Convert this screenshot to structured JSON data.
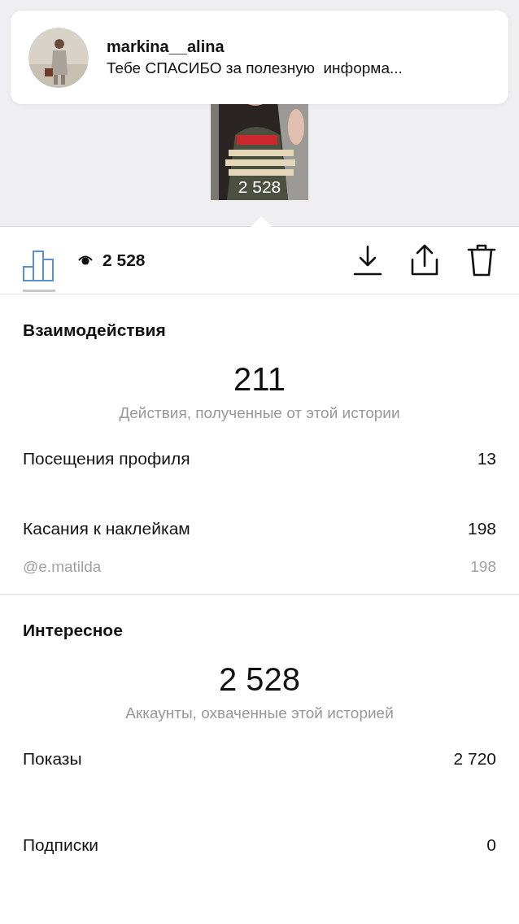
{
  "notification": {
    "username": "markina__alina",
    "message": "Тебе СПАСИБО за полезную  информа..."
  },
  "story": {
    "views": "2 528"
  },
  "toolbar": {
    "views": "2 528",
    "insights_selected": true
  },
  "sections": [
    {
      "title": "Взаимодействия",
      "total": "211",
      "caption": "Действия, полученные от этой истории",
      "rows": [
        {
          "kind": "main",
          "label": "Посещения профиля",
          "value": "13"
        },
        {
          "kind": "main",
          "label": "Касания к наклейкам",
          "value": "198"
        },
        {
          "kind": "sub",
          "label": "@e.matilda",
          "value": "198"
        }
      ]
    },
    {
      "title": "Интересное",
      "total": "2 528",
      "caption": "Аккаунты, охваченные этой историей",
      "rows": [
        {
          "kind": "main",
          "label": "Показы",
          "value": "2 720"
        },
        {
          "kind": "main",
          "label": "Подписки",
          "value": "0"
        }
      ]
    }
  ]
}
